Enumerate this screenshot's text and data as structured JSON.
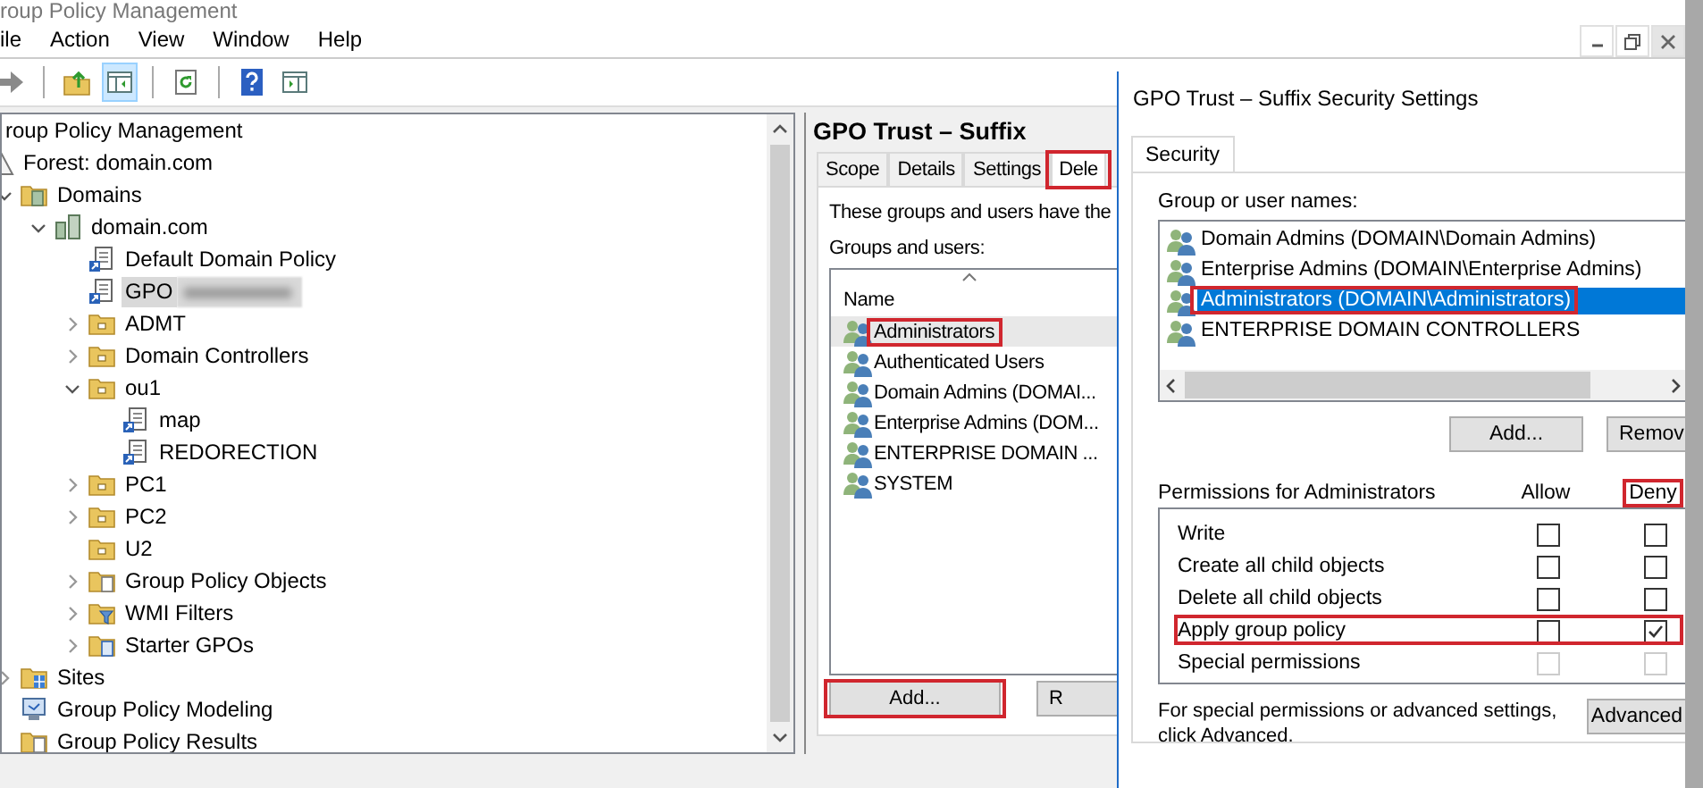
{
  "window": {
    "title": "roup Policy Management"
  },
  "menu": [
    "ile",
    "Action",
    "View",
    "Window",
    "Help"
  ],
  "toolbar": [
    {
      "kind": "back",
      "pressed": false
    },
    {
      "kind": "separator"
    },
    {
      "kind": "up",
      "pressed": false
    },
    {
      "kind": "tree",
      "pressed": true
    },
    {
      "kind": "separator"
    },
    {
      "kind": "refresh",
      "pressed": false
    },
    {
      "kind": "separator"
    },
    {
      "kind": "help",
      "pressed": false
    },
    {
      "kind": "pane",
      "pressed": false
    }
  ],
  "tree": [
    {
      "label": "roup Policy Management",
      "kind": "root",
      "selected": false,
      "children": [
        {
          "label": "Forest: domain.com",
          "kind": "forest",
          "selected": false,
          "children": [
            {
              "label": "Domains",
              "kind": "domains",
              "selected": false,
              "expanded": true,
              "children": [
                {
                  "label": "domain.com",
                  "kind": "domain",
                  "selected": false,
                  "expanded": true,
                  "children": [
                    {
                      "label": "Default Domain Policy",
                      "kind": "gpo-link",
                      "selected": false
                    },
                    {
                      "label": "GPO",
                      "kind": "gpo-link",
                      "selected": true,
                      "redacted": true
                    },
                    {
                      "label": "ADMT",
                      "kind": "ou",
                      "selected": false,
                      "expanded": false
                    },
                    {
                      "label": "Domain Controllers",
                      "kind": "ou",
                      "selected": false,
                      "expanded": false
                    },
                    {
                      "label": "ou1",
                      "kind": "ou",
                      "selected": false,
                      "expanded": true,
                      "children": [
                        {
                          "label": "map",
                          "kind": "gpo-link",
                          "selected": false
                        },
                        {
                          "label": "REDORECTION",
                          "kind": "gpo-link",
                          "selected": false
                        }
                      ]
                    },
                    {
                      "label": "PC1",
                      "kind": "ou",
                      "selected": false,
                      "expanded": false
                    },
                    {
                      "label": "PC2",
                      "kind": "ou",
                      "selected": false,
                      "expanded": false
                    },
                    {
                      "label": "U2",
                      "kind": "ou",
                      "selected": false
                    },
                    {
                      "label": "Group Policy Objects",
                      "kind": "gpo-folder",
                      "selected": false,
                      "expanded": false
                    },
                    {
                      "label": "WMI Filters",
                      "kind": "wmi",
                      "selected": false,
                      "expanded": false
                    },
                    {
                      "label": "Starter GPOs",
                      "kind": "starter",
                      "selected": false,
                      "expanded": false
                    }
                  ]
                }
              ]
            },
            {
              "label": "Sites",
              "kind": "sites",
              "selected": false,
              "expanded": false
            },
            {
              "label": "Group Policy Modeling",
              "kind": "modeling",
              "selected": false
            },
            {
              "label": "Group Policy Results",
              "kind": "results",
              "selected": false
            }
          ]
        }
      ]
    }
  ],
  "gpo_panel": {
    "title": "GPO Trust – Suffix",
    "tabs": [
      {
        "label": "Scope",
        "selected": false,
        "annotated": false
      },
      {
        "label": "Details",
        "selected": false,
        "annotated": false
      },
      {
        "label": "Settings",
        "selected": false,
        "annotated": false
      },
      {
        "label": "Dele",
        "selected": true,
        "annotated": true
      }
    ],
    "intro": "These groups and users have the",
    "list_label": "Groups and users:",
    "column": "Name",
    "rows": [
      {
        "name": "Administrators",
        "selected": true,
        "annotated": true
      },
      {
        "name": "Authenticated Users",
        "selected": false,
        "annotated": false
      },
      {
        "name": "Domain Admins (DOMAI...",
        "selected": false,
        "annotated": false
      },
      {
        "name": "Enterprise Admins (DOM...",
        "selected": false,
        "annotated": false
      },
      {
        "name": "ENTERPRISE DOMAIN ...",
        "selected": false,
        "annotated": false
      },
      {
        "name": "SYSTEM",
        "selected": false,
        "annotated": false
      }
    ],
    "buttons": [
      {
        "label": "Add...",
        "annotated": true
      },
      {
        "label": "R",
        "annotated": false
      }
    ]
  },
  "dialog": {
    "title": "GPO Trust – Suffix Security Settings",
    "tabs": [
      {
        "label": "Security",
        "selected": true
      }
    ],
    "names_label": "Group or user names:",
    "names": [
      {
        "name": "Domain Admins (DOMAIN\\Domain Admins)",
        "selected": false,
        "annotated": false
      },
      {
        "name": "Enterprise Admins (DOMAIN\\Enterprise Admins)",
        "selected": false,
        "annotated": false
      },
      {
        "name": "Administrators (DOMAIN\\Administrators)",
        "selected": true,
        "annotated": true
      },
      {
        "name": "ENTERPRISE DOMAIN CONTROLLERS",
        "selected": false,
        "annotated": false
      }
    ],
    "buttons": [
      "Add...",
      "Remov"
    ],
    "permissions_label": "Permissions for Administrators",
    "columns": [
      {
        "label": "Allow",
        "annotated": false
      },
      {
        "label": "Deny",
        "annotated": true
      }
    ],
    "permissions": [
      {
        "name": "Write",
        "allow": false,
        "deny": false,
        "disabled": false,
        "annotated": false
      },
      {
        "name": "Create all child objects",
        "allow": false,
        "deny": false,
        "disabled": false,
        "annotated": false
      },
      {
        "name": "Delete all child objects",
        "allow": false,
        "deny": false,
        "disabled": false,
        "annotated": false
      },
      {
        "name": "Apply group policy",
        "allow": false,
        "deny": true,
        "disabled": false,
        "annotated": true
      },
      {
        "name": "Special permissions",
        "allow": false,
        "deny": false,
        "disabled": true,
        "annotated": false
      }
    ],
    "advanced_note": "For special permissions or advanced settings, click Advanced.",
    "advanced_button": "Advanced"
  }
}
